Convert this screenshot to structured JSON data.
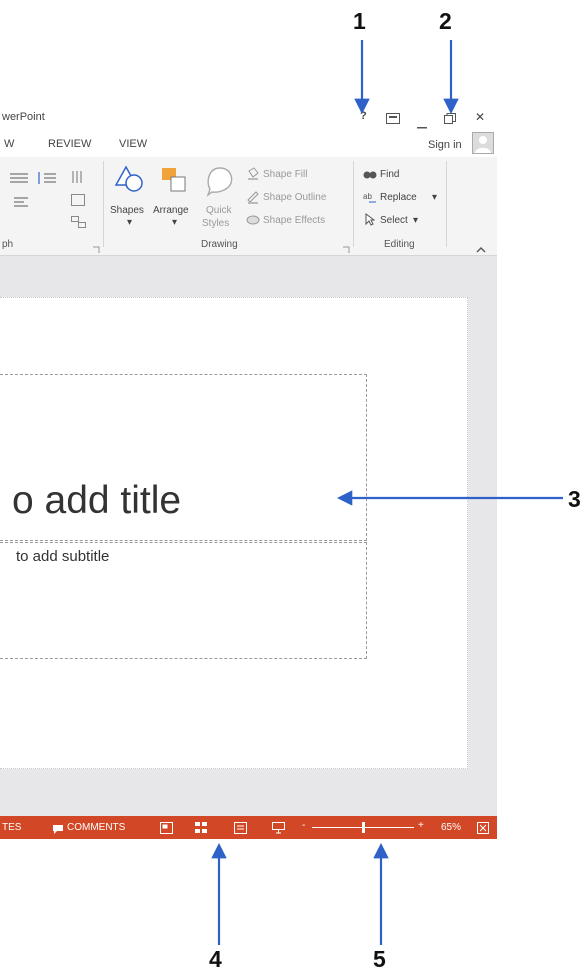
{
  "window": {
    "title_fragment": "werPoint",
    "title_controls": {
      "help": "?",
      "close": "✕"
    },
    "sign_in": "Sign in"
  },
  "tabs": [
    "W",
    "REVIEW",
    "VIEW"
  ],
  "ribbon": {
    "drawing": {
      "shapes_label": "Shapes",
      "arrange_label": "Arrange",
      "quick_styles_label": "Quick",
      "quick_styles_label2": "Styles",
      "shape_fill": "Shape Fill",
      "shape_outline": "Shape Outline",
      "shape_effects": "Shape Effects",
      "group_label": "Drawing"
    },
    "editing": {
      "find": "Find",
      "replace": "Replace",
      "select": "Select",
      "group_label": "Editing"
    },
    "paragraph_group_label": "ph"
  },
  "slide": {
    "title_placeholder": "o add title",
    "subtitle_placeholder": "to add subtitle"
  },
  "statusbar": {
    "notes_fragment": "TES",
    "comments": "COMMENTS",
    "zoom_level": "65%",
    "zoom_fraction": 0.5
  },
  "callouts": [
    "1",
    "2",
    "3",
    "4",
    "5"
  ],
  "colors": {
    "accent": "#d24726",
    "arrow": "#2e62c9"
  }
}
